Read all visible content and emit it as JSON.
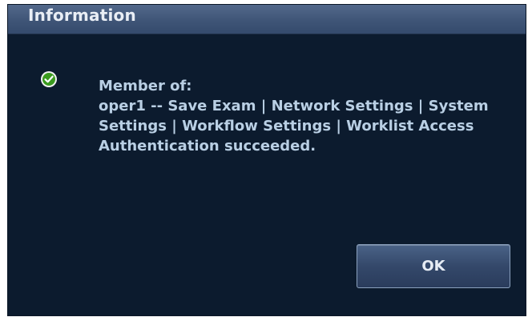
{
  "dialog": {
    "title": "Information",
    "icon": "check-circle-icon",
    "accent_color": "#3a9a1e",
    "message_lines": [
      "Member of:",
      "oper1 -- Save Exam | Network Settings | System",
      "Settings | Workflow Settings | Worklist Access",
      "Authentication succeeded."
    ],
    "ok_label": "OK"
  }
}
